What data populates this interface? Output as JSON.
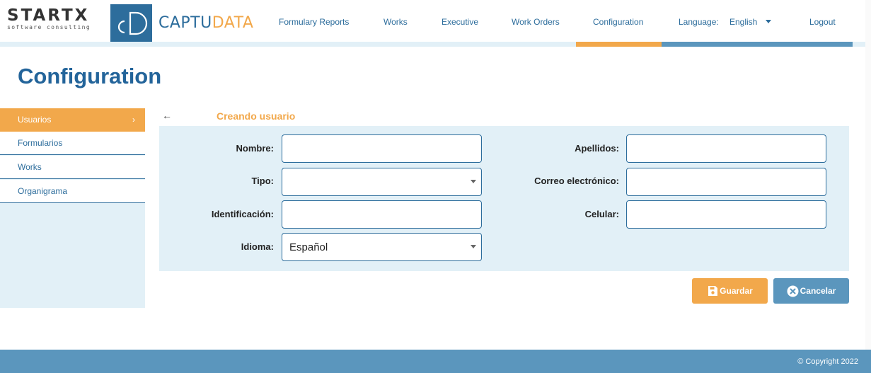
{
  "brand": {
    "startx_word": "STARTX",
    "startx_tagline": "software consulting",
    "cd_mark": "cD",
    "captu": "CAPTU",
    "data": "DATA"
  },
  "nav": {
    "items": [
      {
        "label": "Formulary Reports"
      },
      {
        "label": "Works"
      },
      {
        "label": "Executive"
      },
      {
        "label": "Work Orders"
      },
      {
        "label": "Configuration"
      }
    ],
    "language_label": "Language:",
    "language_value": "English",
    "logout": "Logout"
  },
  "page_title": "Configuration",
  "sidebar": {
    "items": [
      {
        "label": "Usuarios",
        "active": true
      },
      {
        "label": "Formularios"
      },
      {
        "label": "Works"
      },
      {
        "label": "Organigrama"
      }
    ],
    "chevron_icon": "chevron-right-icon"
  },
  "form": {
    "back_icon": "arrow-left-icon",
    "title": "Creando usuario",
    "fields": {
      "nombre": {
        "label": "Nombre:",
        "value": ""
      },
      "apellidos": {
        "label": "Apellidos:",
        "value": ""
      },
      "tipo": {
        "label": "Tipo:",
        "value": ""
      },
      "correo": {
        "label": "Correo electrónico:",
        "value": ""
      },
      "identificacion": {
        "label": "Identificación:",
        "value": ""
      },
      "celular": {
        "label": "Celular:",
        "value": ""
      },
      "idioma": {
        "label": "Idioma:",
        "value": "Español"
      }
    }
  },
  "buttons": {
    "save": {
      "label": "Guardar",
      "icon": "floppy-disk-icon"
    },
    "cancel": {
      "label": "Cancelar",
      "icon": "close-circle-icon"
    }
  },
  "footer": {
    "copyright": "© Copyright 2022"
  },
  "colors": {
    "primary": "#2d6d9c",
    "accent": "#f2a84b",
    "panel": "#e2f0f7",
    "footer": "#5b96bd"
  }
}
